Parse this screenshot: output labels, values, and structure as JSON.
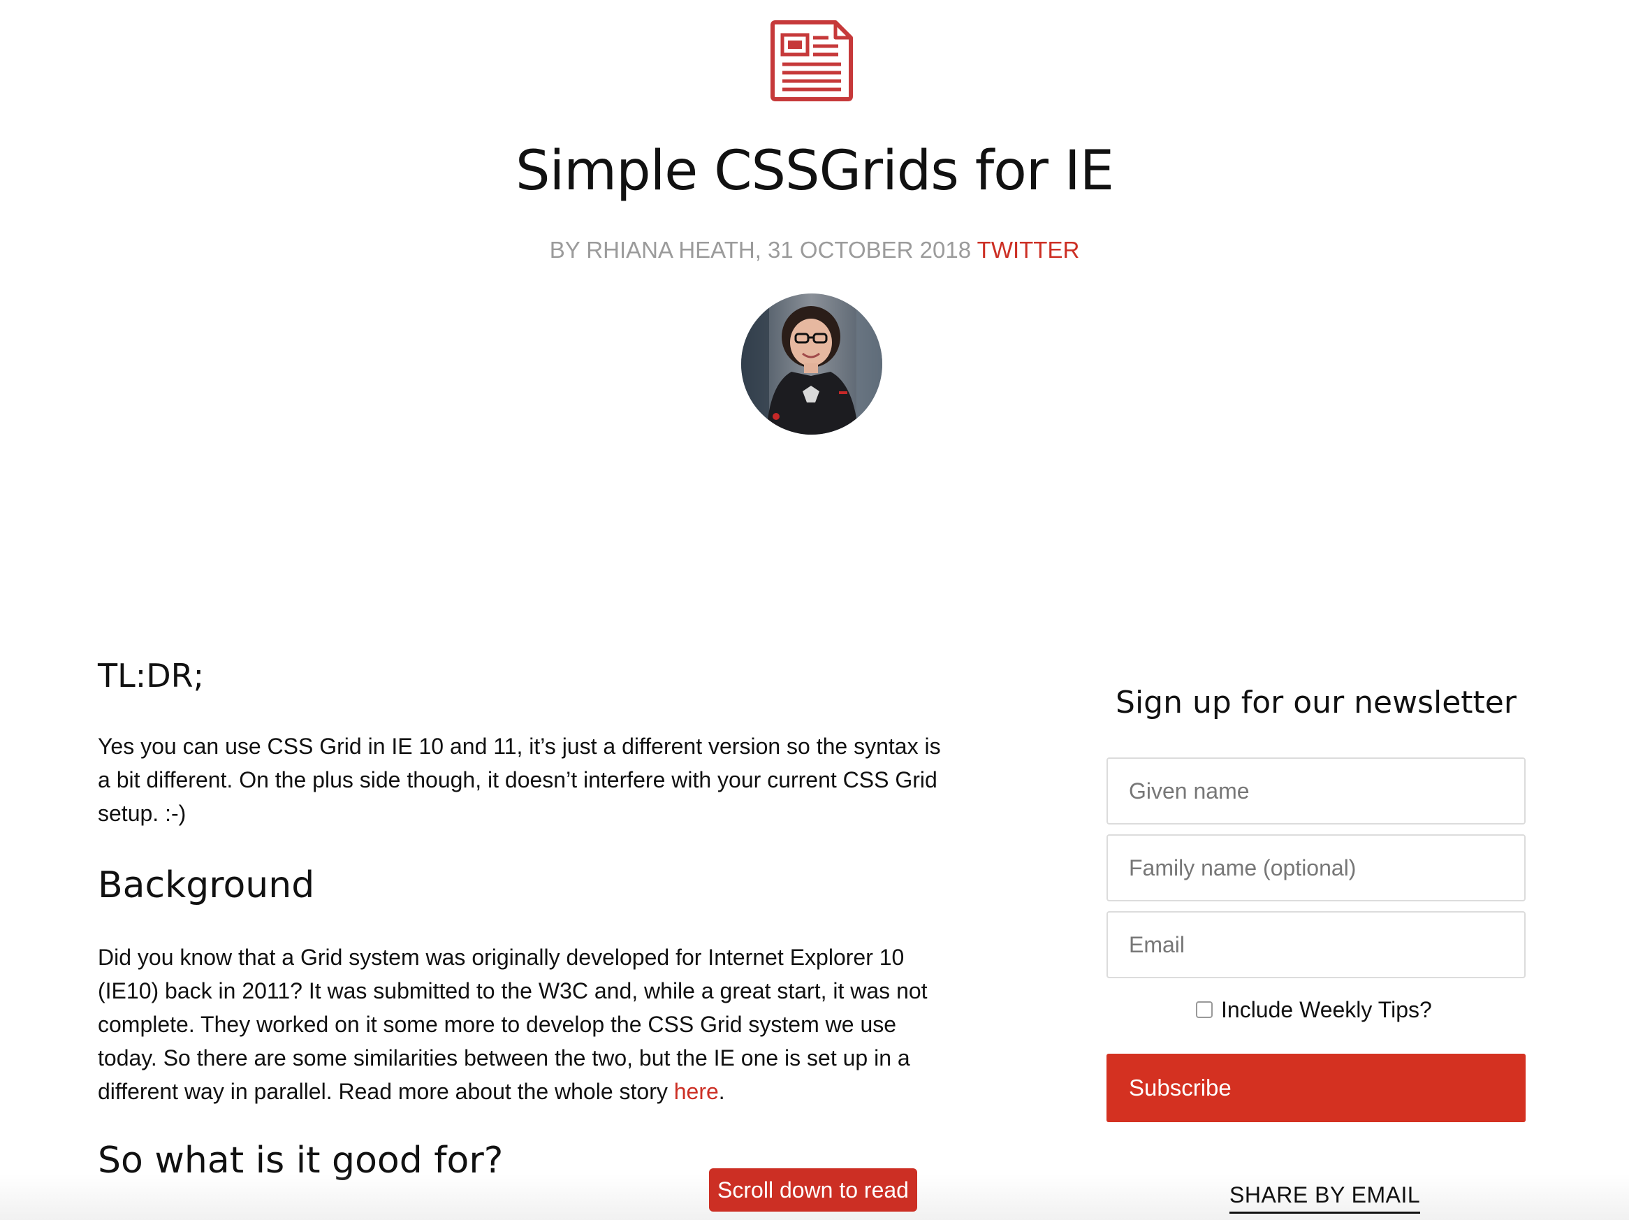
{
  "header": {
    "icon": "newspaper-icon",
    "title": "Simple CSSGrids for IE",
    "byline": "BY RHIANA HEATH, 31 OCTOBER 2018",
    "twitter_label": "TWITTER",
    "avatar": "author-avatar"
  },
  "article": {
    "tldr_heading": "TL:DR;",
    "tldr_text": "Yes you can use CSS Grid in IE 10 and 11, it’s just a different version so the syntax is a bit different. On the plus side though, it doesn’t interfere with your current CSS Grid setup. :-)",
    "background_heading": "Background",
    "background_text": "Did you know that a Grid system was originally developed for Internet Explorer 10 (IE10) back in 2011? It was submitted to the W3C and, while a great start, it was not complete. They worked on it some more to develop the CSS Grid system we use today. So there are some similarities between the two, but the IE one is set up in a different way in parallel. Read more about the whole story",
    "background_link": "here",
    "background_end": ".",
    "good_heading": "So what is it good for?",
    "scroll_button": "Scroll down to read"
  },
  "newsletter": {
    "title": "Sign up for our newsletter",
    "given_placeholder": "Given name",
    "family_placeholder": "Family name (optional)",
    "email_placeholder": "Email",
    "tips_label": "Include Weekly Tips?",
    "tips_checked": false,
    "subscribe_label": "Subscribe",
    "share_label": "SHARE BY EMAIL"
  },
  "colors": {
    "accent": "#cc2f24",
    "subscribe": "#d43121",
    "byline": "#9b9b9b"
  }
}
